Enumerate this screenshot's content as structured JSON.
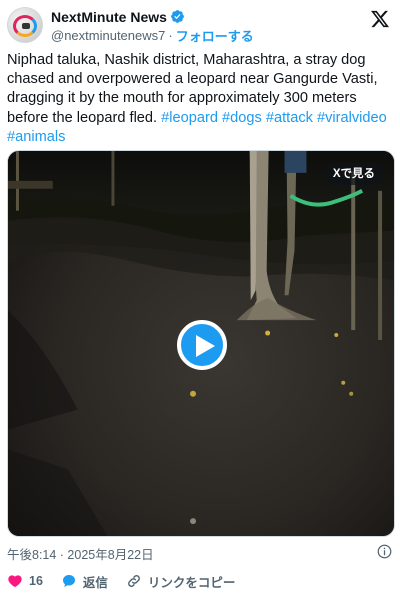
{
  "author": {
    "display_name": "NextMinute News",
    "handle": "@nextminutenews7",
    "separator": "·",
    "follow_label": "フォローする",
    "verified": true
  },
  "tweet": {
    "text_plain": "Niphad taluka, Nashik district, Maharashtra, a stray dog chased and overpowered a leopard near Gangurde Vasti, dragging it by the mouth for approximately 300 meters before the leopard fled. ",
    "hashtags": [
      "#leopard",
      "#dogs",
      "#attack",
      "#viralvideo",
      "#animals"
    ]
  },
  "media": {
    "view_on_x_label": "Xで見る",
    "play_icon": "play-icon"
  },
  "timestamp": "午後8:14 · 2025年8月22日",
  "actions": {
    "like_count": "16",
    "reply_label": "返信",
    "copy_link_label": "リンクをコピー"
  },
  "colors": {
    "accent": "#1d9bf0",
    "like": "#f91880",
    "text": "#0f1419",
    "secondary": "#536471"
  }
}
